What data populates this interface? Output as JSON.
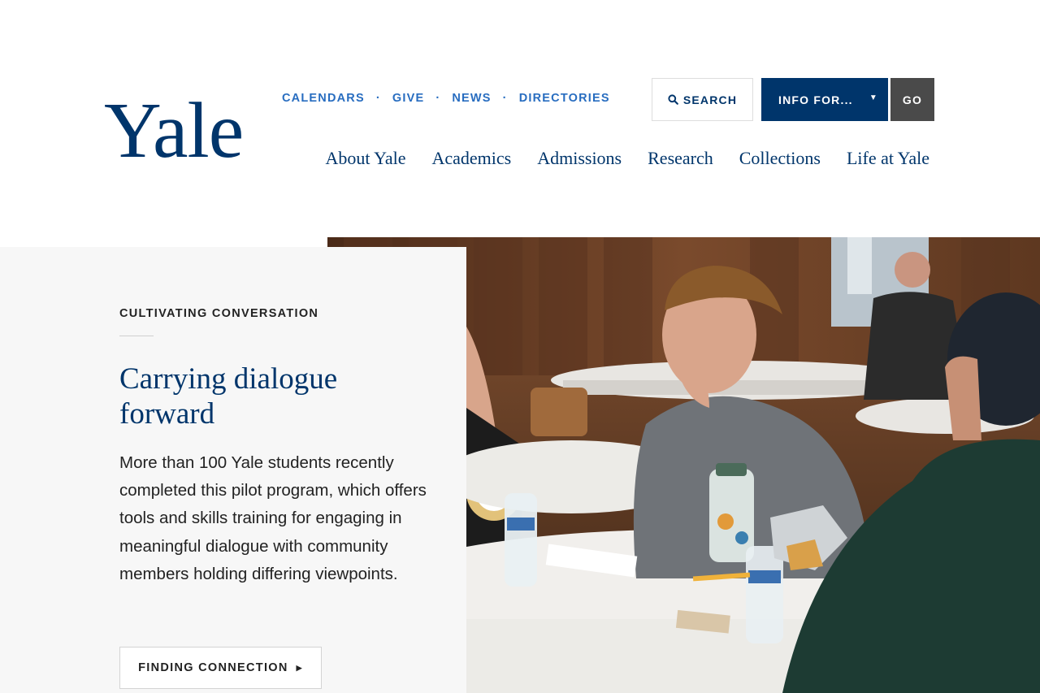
{
  "header": {
    "logo_text": "Yale",
    "utility_nav": [
      "CALENDARS",
      "GIVE",
      "NEWS",
      "DIRECTORIES"
    ],
    "utility_separator": "·",
    "search_label": "SEARCH",
    "info_select_value": "INFO FOR...",
    "go_label": "GO",
    "main_nav": [
      "About Yale",
      "Academics",
      "Admissions",
      "Research",
      "Collections",
      "Life at Yale"
    ]
  },
  "hero": {
    "eyebrow": "CULTIVATING CONVERSATION",
    "headline": "Carrying dialogue forward",
    "body": "More than 100 Yale students recently completed this pilot program, which offers tools and skills training for engaging in meaningful dialogue with community members holding differing viewpoints.",
    "cta_label": "FINDING CONNECTION"
  },
  "colors": {
    "yale_blue": "#00356b",
    "link_blue": "#286dc0",
    "go_gray": "#4a4a4a",
    "panel_gray": "#f7f7f7"
  },
  "icons": {
    "search": "search-icon",
    "dropdown": "chevron-down-icon",
    "cta_arrow": "chevron-right-icon"
  }
}
